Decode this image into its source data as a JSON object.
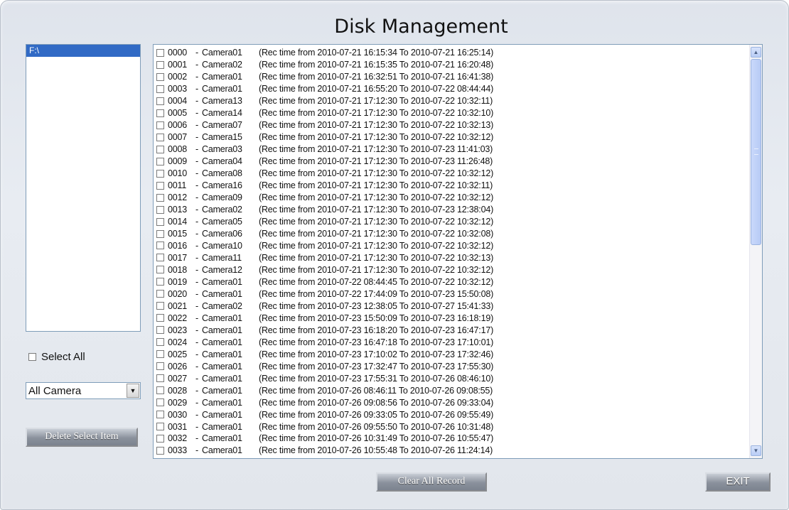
{
  "title": "Disk Management",
  "drives": [
    "F:\\"
  ],
  "select_all_label": "Select All",
  "camera_filter": "All Camera",
  "buttons": {
    "delete": "Delete Select Item",
    "clear": "Clear All Record",
    "exit": "EXIT"
  },
  "records": [
    {
      "id": "0000",
      "camera": "Camera01",
      "time": "(Rec time from 2010-07-21 16:15:34 To 2010-07-21 16:25:14)"
    },
    {
      "id": "0001",
      "camera": "Camera02",
      "time": "(Rec time from 2010-07-21 16:15:35 To 2010-07-21 16:20:48)"
    },
    {
      "id": "0002",
      "camera": "Camera01",
      "time": "(Rec time from 2010-07-21 16:32:51 To 2010-07-21 16:41:38)"
    },
    {
      "id": "0003",
      "camera": "Camera01",
      "time": "(Rec time from 2010-07-21 16:55:20 To 2010-07-22 08:44:44)"
    },
    {
      "id": "0004",
      "camera": "Camera13",
      "time": "(Rec time from 2010-07-21 17:12:30 To 2010-07-22 10:32:11)"
    },
    {
      "id": "0005",
      "camera": "Camera14",
      "time": "(Rec time from 2010-07-21 17:12:30 To 2010-07-22 10:32:10)"
    },
    {
      "id": "0006",
      "camera": "Camera07",
      "time": "(Rec time from 2010-07-21 17:12:30 To 2010-07-22 10:32:13)"
    },
    {
      "id": "0007",
      "camera": "Camera15",
      "time": "(Rec time from 2010-07-21 17:12:30 To 2010-07-22 10:32:12)"
    },
    {
      "id": "0008",
      "camera": "Camera03",
      "time": "(Rec time from 2010-07-21 17:12:30 To 2010-07-23 11:41:03)"
    },
    {
      "id": "0009",
      "camera": "Camera04",
      "time": "(Rec time from 2010-07-21 17:12:30 To 2010-07-23 11:26:48)"
    },
    {
      "id": "0010",
      "camera": "Camera08",
      "time": "(Rec time from 2010-07-21 17:12:30 To 2010-07-22 10:32:12)"
    },
    {
      "id": "0011",
      "camera": "Camera16",
      "time": "(Rec time from 2010-07-21 17:12:30 To 2010-07-22 10:32:11)"
    },
    {
      "id": "0012",
      "camera": "Camera09",
      "time": "(Rec time from 2010-07-21 17:12:30 To 2010-07-22 10:32:12)"
    },
    {
      "id": "0013",
      "camera": "Camera02",
      "time": "(Rec time from 2010-07-21 17:12:30 To 2010-07-23 12:38:04)"
    },
    {
      "id": "0014",
      "camera": "Camera05",
      "time": "(Rec time from 2010-07-21 17:12:30 To 2010-07-22 10:32:12)"
    },
    {
      "id": "0015",
      "camera": "Camera06",
      "time": "(Rec time from 2010-07-21 17:12:30 To 2010-07-22 10:32:08)"
    },
    {
      "id": "0016",
      "camera": "Camera10",
      "time": "(Rec time from 2010-07-21 17:12:30 To 2010-07-22 10:32:12)"
    },
    {
      "id": "0017",
      "camera": "Camera11",
      "time": "(Rec time from 2010-07-21 17:12:30 To 2010-07-22 10:32:13)"
    },
    {
      "id": "0018",
      "camera": "Camera12",
      "time": "(Rec time from 2010-07-21 17:12:30 To 2010-07-22 10:32:12)"
    },
    {
      "id": "0019",
      "camera": "Camera01",
      "time": "(Rec time from 2010-07-22 08:44:45 To 2010-07-22 10:32:12)"
    },
    {
      "id": "0020",
      "camera": "Camera01",
      "time": "(Rec time from 2010-07-22 17:44:09 To 2010-07-23 15:50:08)"
    },
    {
      "id": "0021",
      "camera": "Camera02",
      "time": "(Rec time from 2010-07-23 12:38:05 To 2010-07-27 15:41:33)"
    },
    {
      "id": "0022",
      "camera": "Camera01",
      "time": "(Rec time from 2010-07-23 15:50:09 To 2010-07-23 16:18:19)"
    },
    {
      "id": "0023",
      "camera": "Camera01",
      "time": "(Rec time from 2010-07-23 16:18:20 To 2010-07-23 16:47:17)"
    },
    {
      "id": "0024",
      "camera": "Camera01",
      "time": "(Rec time from 2010-07-23 16:47:18 To 2010-07-23 17:10:01)"
    },
    {
      "id": "0025",
      "camera": "Camera01",
      "time": "(Rec time from 2010-07-23 17:10:02 To 2010-07-23 17:32:46)"
    },
    {
      "id": "0026",
      "camera": "Camera01",
      "time": "(Rec time from 2010-07-23 17:32:47 To 2010-07-23 17:55:30)"
    },
    {
      "id": "0027",
      "camera": "Camera01",
      "time": "(Rec time from 2010-07-23 17:55:31 To 2010-07-26 08:46:10)"
    },
    {
      "id": "0028",
      "camera": "Camera01",
      "time": "(Rec time from 2010-07-26 08:46:11 To 2010-07-26 09:08:55)"
    },
    {
      "id": "0029",
      "camera": "Camera01",
      "time": "(Rec time from 2010-07-26 09:08:56 To 2010-07-26 09:33:04)"
    },
    {
      "id": "0030",
      "camera": "Camera01",
      "time": "(Rec time from 2010-07-26 09:33:05 To 2010-07-26 09:55:49)"
    },
    {
      "id": "0031",
      "camera": "Camera01",
      "time": "(Rec time from 2010-07-26 09:55:50 To 2010-07-26 10:31:48)"
    },
    {
      "id": "0032",
      "camera": "Camera01",
      "time": "(Rec time from 2010-07-26 10:31:49 To 2010-07-26 10:55:47)"
    },
    {
      "id": "0033",
      "camera": "Camera01",
      "time": "(Rec time from 2010-07-26 10:55:48 To 2010-07-26 11:24:14)"
    }
  ],
  "icons": {
    "scroll_up": "scroll-up-arrow-icon",
    "scroll_down": "scroll-down-arrow-icon",
    "dropdown": "chevron-down-icon"
  }
}
